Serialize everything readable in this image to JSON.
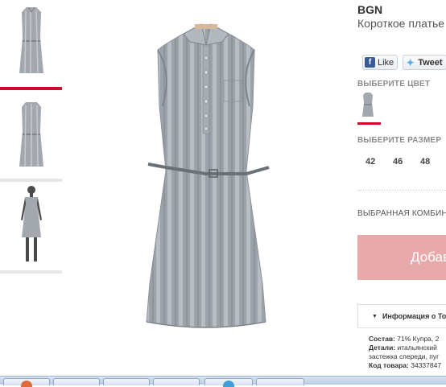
{
  "thumbnails": [
    {
      "name": "front",
      "selected": true
    },
    {
      "name": "back",
      "selected": false
    },
    {
      "name": "on-model",
      "selected": false
    }
  ],
  "product": {
    "brand": "BGN",
    "name": "Короткое платье"
  },
  "social": {
    "like_label": "Like",
    "tweet_label": "Tweet"
  },
  "color_section": {
    "label": "ВЫБЕРИТЕ ЦВЕТ"
  },
  "size_section": {
    "label": "ВЫБЕРИТЕ РАЗМЕР",
    "sizes": [
      "42",
      "46",
      "48"
    ]
  },
  "combination_label": "ВЫБРАННАЯ КОМБИН",
  "add_button_label": "Добав",
  "info": {
    "toggle_label": "Информация о То",
    "composition_label": "Состав:",
    "composition_value": "71% Купра, 2",
    "details_label": "Детали:",
    "details_value": "итальянский",
    "details_line2": "застежка спереди, пуг",
    "code_label": "Код товара:",
    "code_value": "34337847"
  },
  "colors": {
    "accent": "#c8102e",
    "add_button": "#e8a9ab",
    "dress": "#9aa0a8"
  },
  "icons": [
    "facebook-icon",
    "twitter-icon",
    "triangle-down-icon"
  ]
}
